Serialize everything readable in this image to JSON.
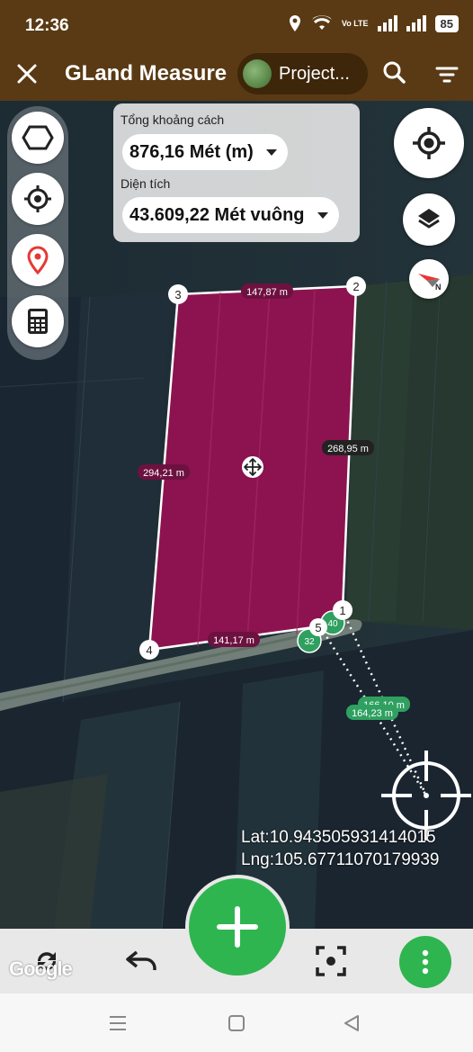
{
  "status_bar": {
    "time": "12:36",
    "network": "Vo LTE",
    "battery": "85"
  },
  "app_bar": {
    "title": "GLand Measure",
    "project_label": "Project..."
  },
  "measure_panel": {
    "distance_label": "Tổng khoảng cách",
    "distance_value": "876,16 Mét (m)",
    "area_label": "Diện tích",
    "area_value": "43.609,22 Mét vuông"
  },
  "polygon": {
    "vertices": [
      {
        "id": "1",
        "label": "1"
      },
      {
        "id": "2",
        "label": "2"
      },
      {
        "id": "3",
        "label": "3"
      },
      {
        "id": "4",
        "label": "4"
      },
      {
        "id": "5",
        "label": "5"
      }
    ],
    "edge_labels": {
      "top": "147,87 m",
      "right": "268,95 m",
      "left": "294,21 m",
      "bottom": "141,17 m",
      "line_a": "166,10 m",
      "line_b": "164,23 m"
    },
    "markers": {
      "m40": "40",
      "m32": "32"
    },
    "fill_color": "#8c1350"
  },
  "coordinates": {
    "lat": "Lat:10.943505931414015",
    "lng": "Lng:105.67711070179939"
  },
  "map_attribution": "Google",
  "colors": {
    "brand_bar": "#5a3a14",
    "accent_green": "#2fb54f"
  }
}
